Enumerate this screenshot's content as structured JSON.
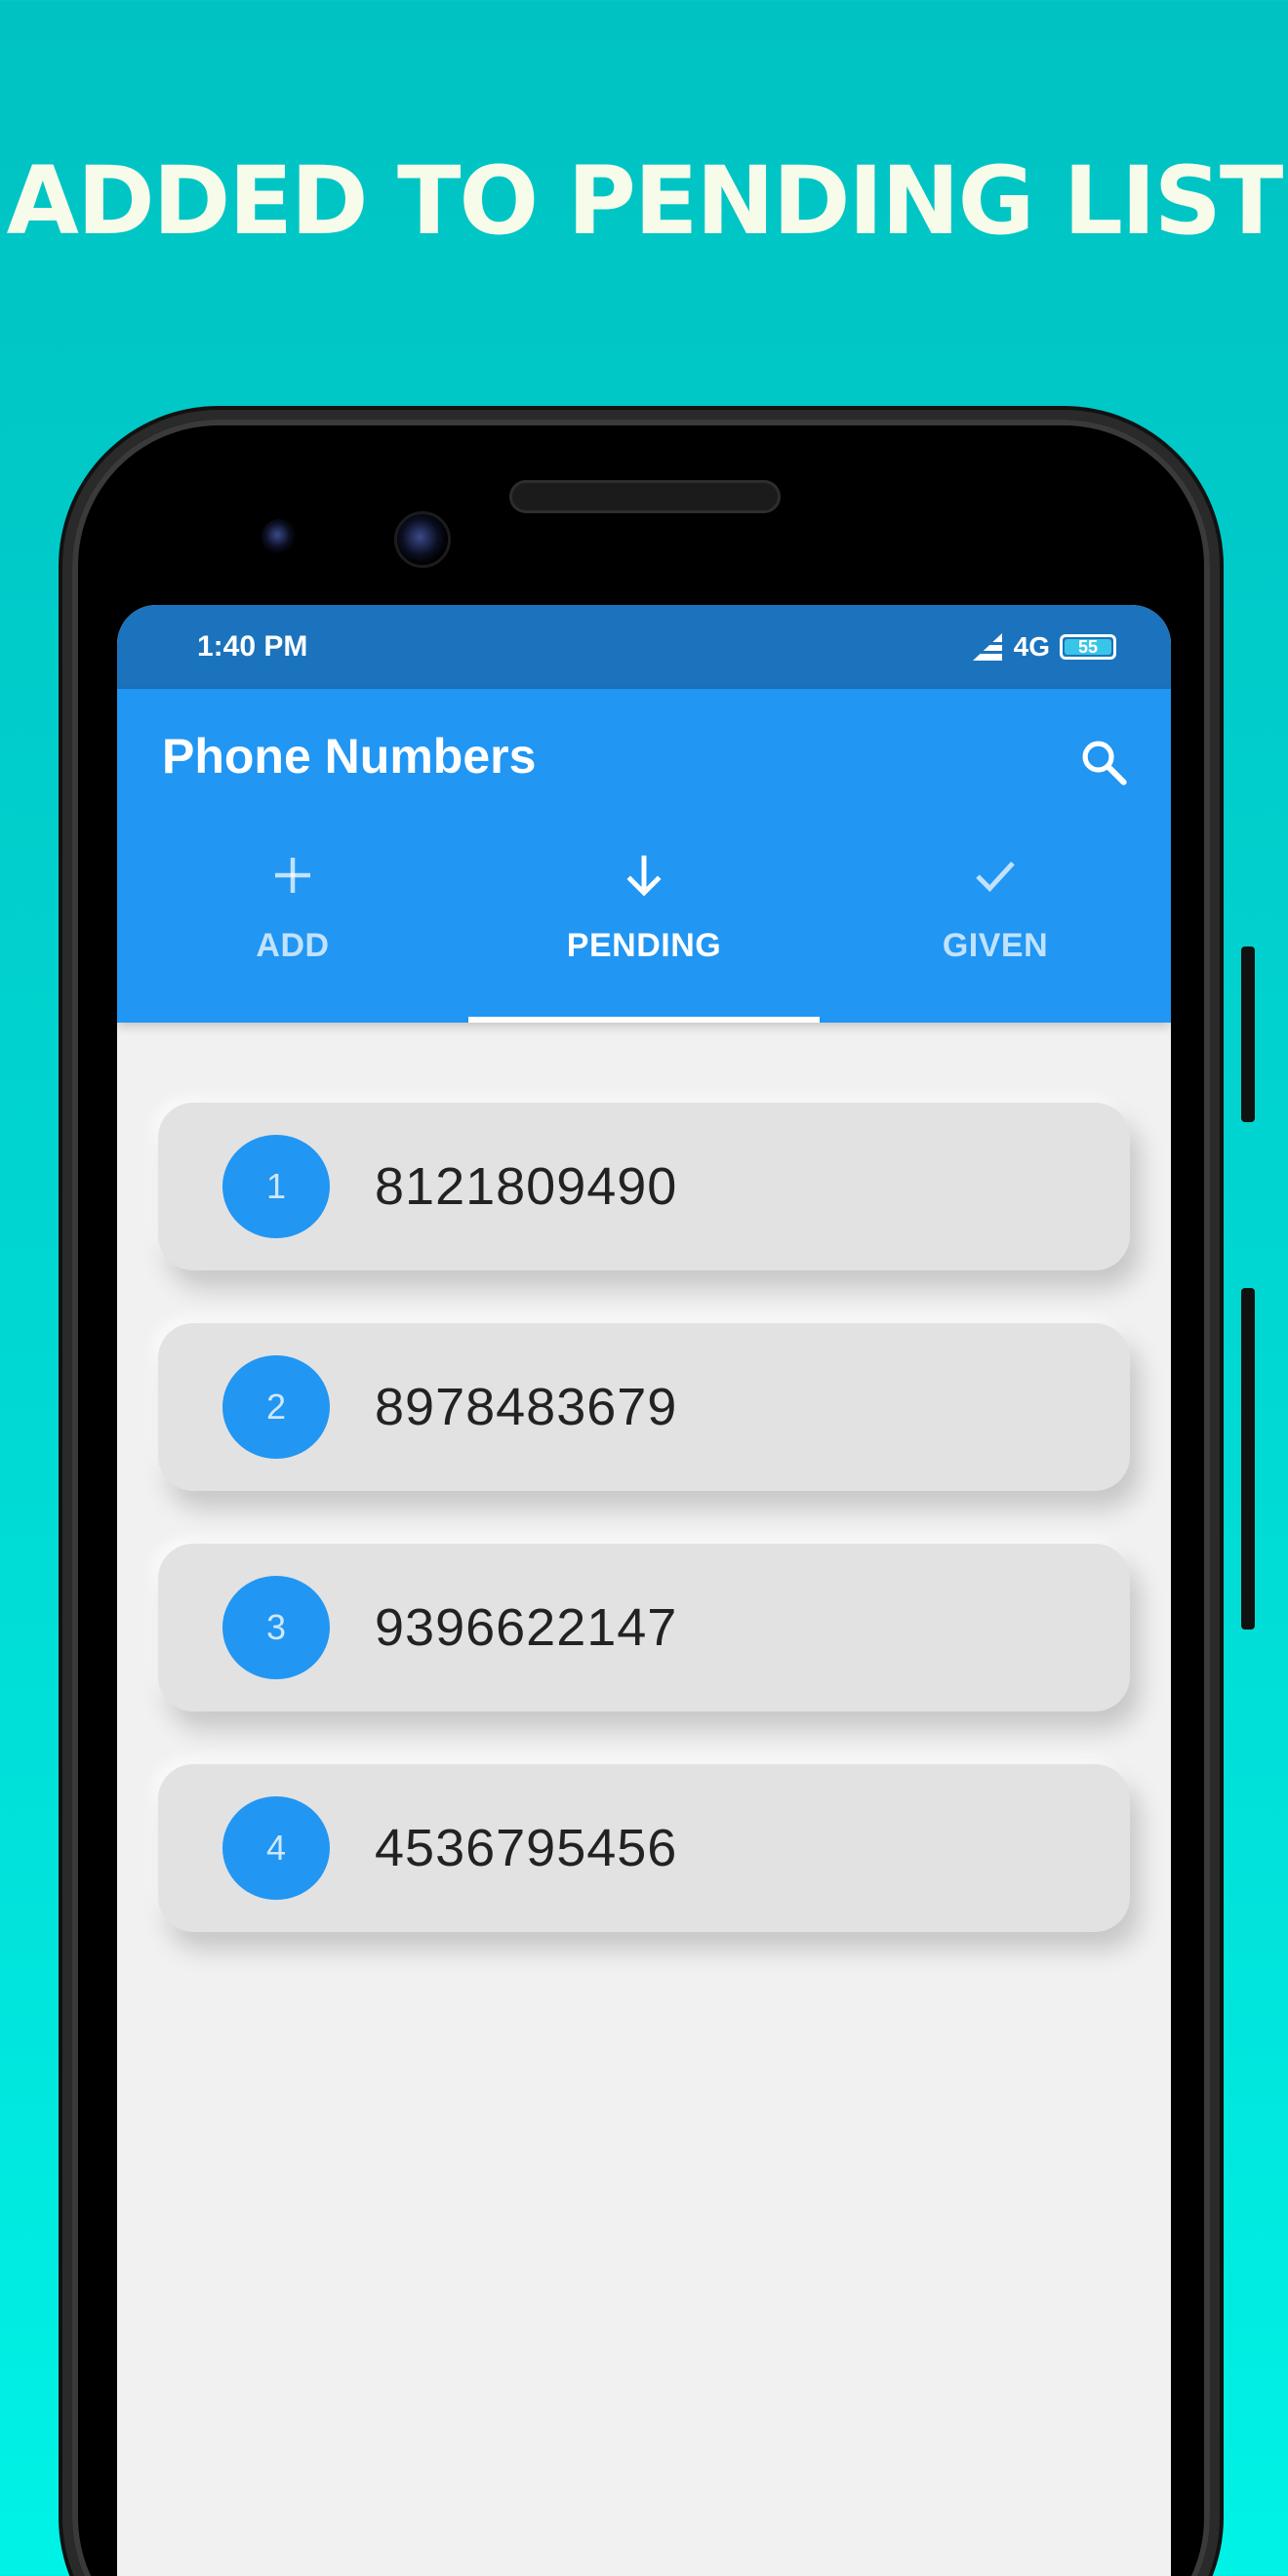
{
  "headline": "ADDED TO PENDING LIST",
  "status_bar": {
    "time": "1:40 PM",
    "network": "4G",
    "battery": "55"
  },
  "app_bar": {
    "title": "Phone Numbers",
    "search_icon": "search-icon"
  },
  "tabs": [
    {
      "label": "ADD",
      "icon": "plus-icon",
      "active": false
    },
    {
      "label": "PENDING",
      "icon": "arrow-down-icon",
      "active": true
    },
    {
      "label": "GIVEN",
      "icon": "check-icon",
      "active": false
    }
  ],
  "numbers": [
    {
      "index": "1",
      "value": "8121809490"
    },
    {
      "index": "2",
      "value": "8978483679"
    },
    {
      "index": "3",
      "value": "9396622147"
    },
    {
      "index": "4",
      "value": "4536795456"
    }
  ],
  "colors": {
    "primary": "#2196F3",
    "status_bar": "#1B73BD",
    "background_top": "#00C2C2",
    "background_bottom": "#00F2E6"
  }
}
